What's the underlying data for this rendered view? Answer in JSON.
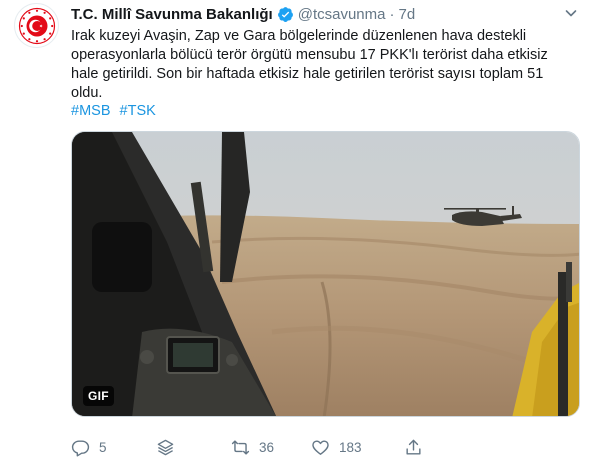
{
  "tweet": {
    "author_name": "T.C. Millî Savunma Bakanlığı",
    "handle": "@tcsavunma",
    "separator": "·",
    "time": "7d",
    "text": "Irak kuzeyi Avaşin, Zap ve Gara bölgelerinde düzenlenen hava destekli operasyonlarla bölücü terör örgütü mensubu 17 PKK'lı terörist daha etkisiz hale getirildi. Son bir haftada  etkisiz hale getirilen terörist sayısı toplam 51 oldu.",
    "hashtags": [
      "#MSB",
      "#TSK"
    ],
    "media_badge": "GIF"
  },
  "actions": {
    "reply_count": "5",
    "retweet_count": "36",
    "like_count": "183"
  },
  "colors": {
    "link": "#1b95e0",
    "muted": "#657786",
    "emblem_red": "#e30a17",
    "verified": "#1da1f2"
  },
  "icons": [
    "emblem-logo-icon",
    "verified-icon",
    "caret-down-icon",
    "reply-icon",
    "stack-icon",
    "retweet-icon",
    "like-icon",
    "share-icon"
  ]
}
